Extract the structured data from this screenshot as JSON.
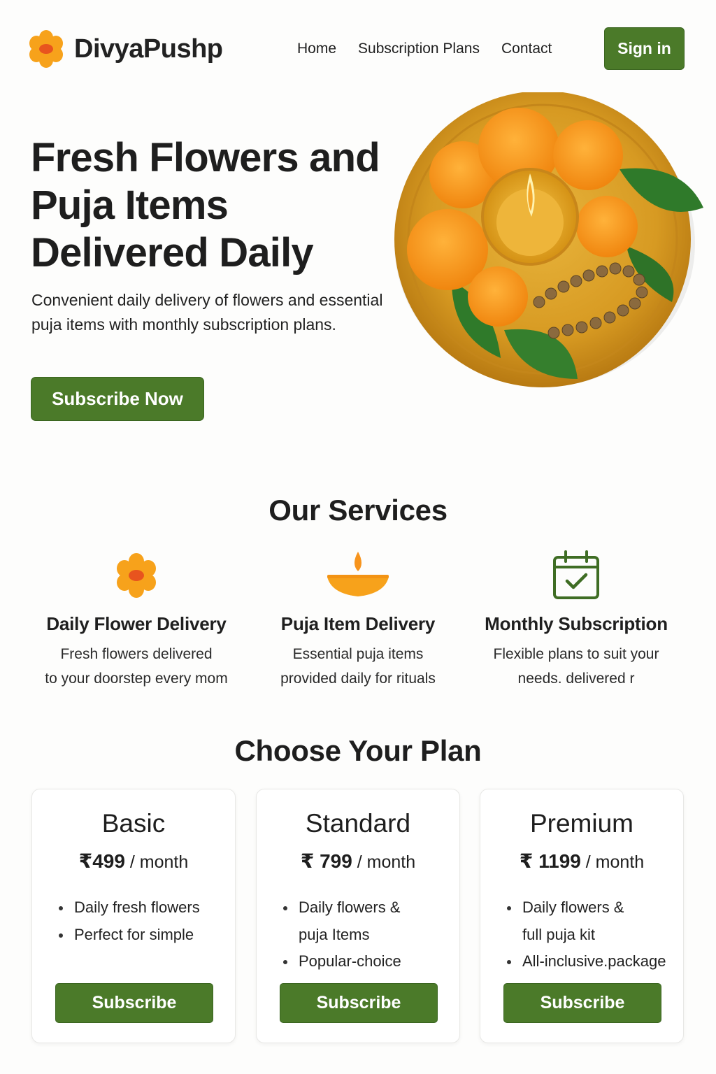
{
  "brand": {
    "name": "DivyaPushp",
    "icon": "marigold-flower-icon"
  },
  "nav": {
    "items": [
      "Home",
      "Subscription Plans",
      "Contact"
    ],
    "sign_in": "Sign in"
  },
  "hero": {
    "title": "Fresh Flowers and Puja Items Delivered Daily",
    "subtitle": "Convenient daily delivery of flowers and essential puja items with monthly subscription plans.",
    "cta": "Subscribe Now",
    "image": "puja-thali-with-marigolds-diya-and-beads"
  },
  "services": {
    "title": "Our Services",
    "items": [
      {
        "icon": "flower-icon",
        "title": "Daily Flower Delivery",
        "desc": "Fresh flowers delivered\nto your doorstep every mom"
      },
      {
        "icon": "diya-lamp-icon",
        "title": "Puja Item Delivery",
        "desc": "Essential puja items\nprovided daily for rituals"
      },
      {
        "icon": "calendar-check-icon",
        "title": "Monthly Subscription",
        "desc": "Flexible plans to suit your\nneeds. delivered r"
      }
    ]
  },
  "plans": {
    "title": "Choose Your Plan",
    "items": [
      {
        "name": "Basic",
        "price": "₹499",
        "period": " / month",
        "features": [
          "Daily fresh flowers",
          "Perfect for simple"
        ],
        "button": "Subscribe"
      },
      {
        "name": "Standard",
        "price": "₹ 799",
        "period": " / month",
        "features": [
          "Daily flowers &\npuja Items",
          "Popular-choice"
        ],
        "button": "Subscribe"
      },
      {
        "name": "Premium",
        "price": "₹ 1199",
        "period": " / month",
        "features": [
          "Daily flowers &\nfull puja kit",
          "All-inclusive.package"
        ],
        "button": "Subscribe"
      }
    ]
  },
  "colors": {
    "accent_green": "#4b7a29",
    "marigold": "#f7a21b",
    "flower_center": "#e8541e"
  }
}
